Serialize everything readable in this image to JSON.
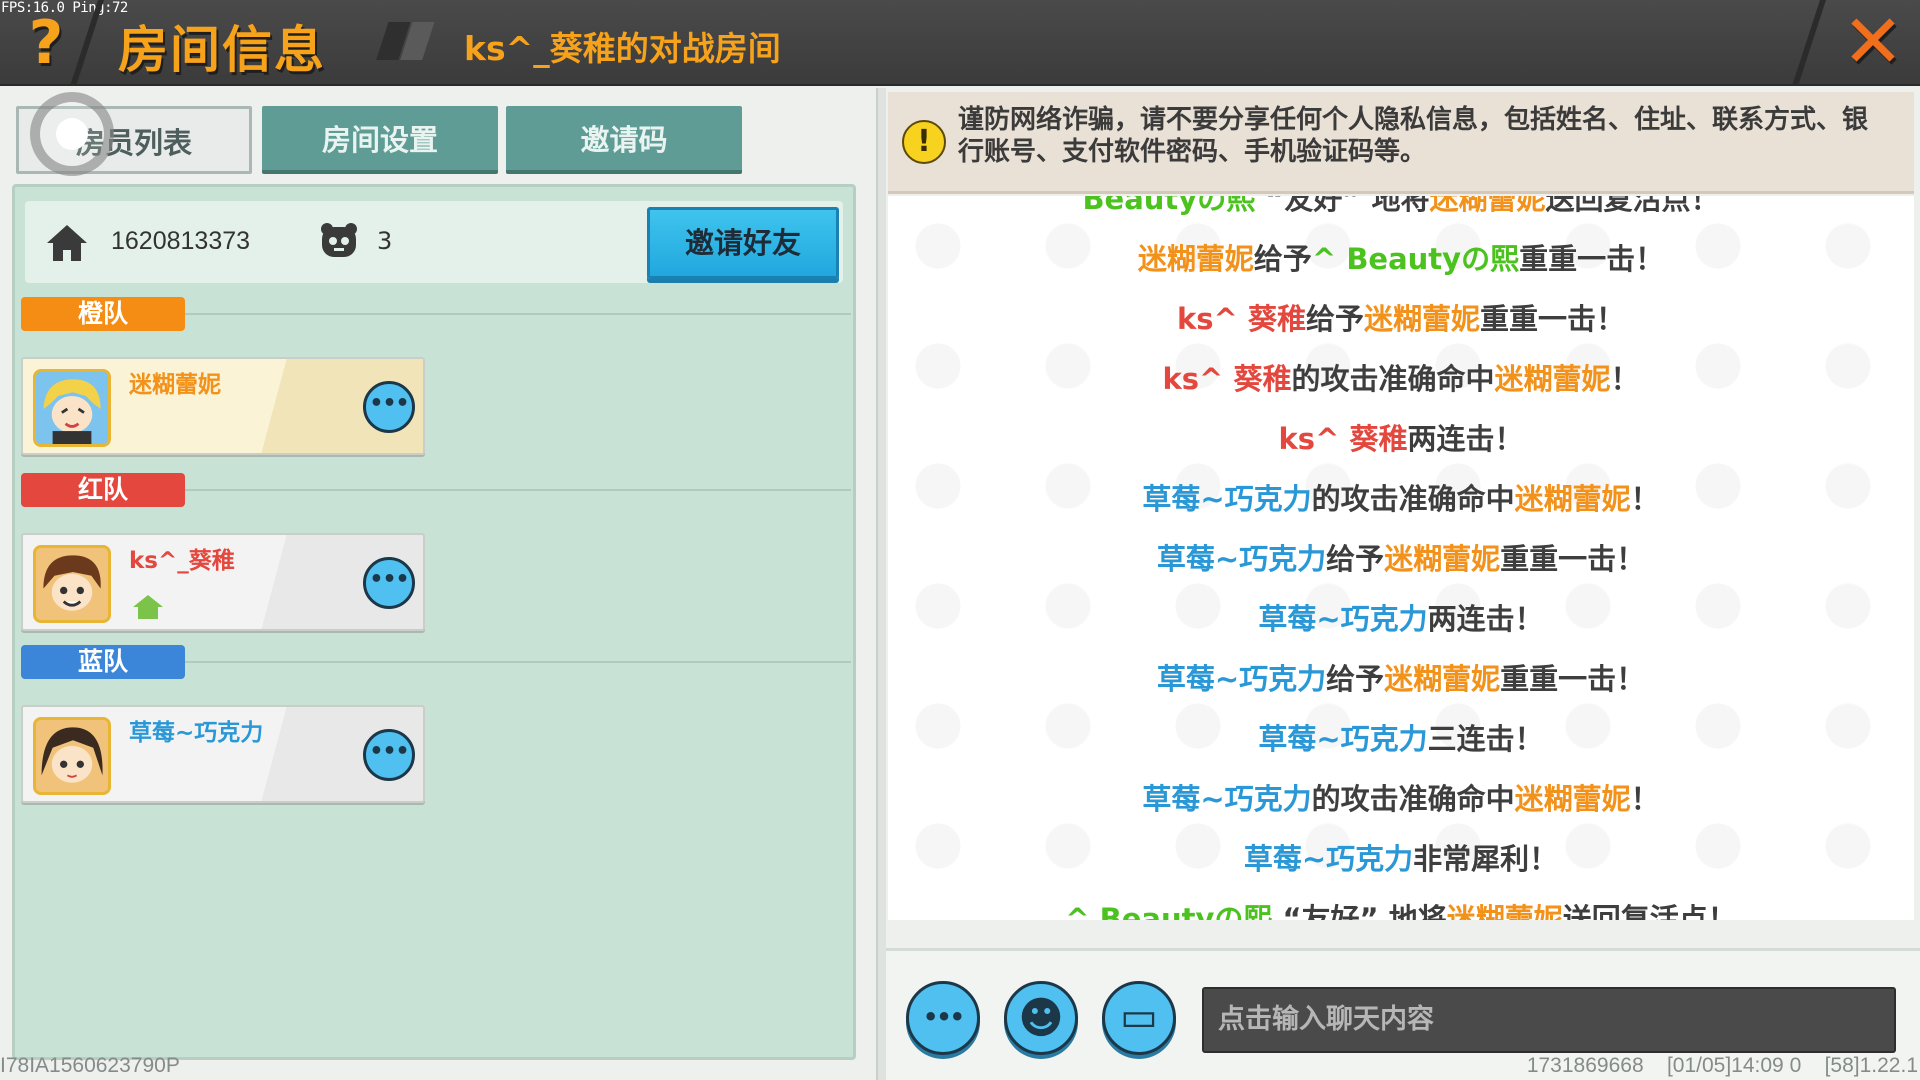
{
  "status": {
    "fps": "FPS:16.0 Ping:72"
  },
  "header": {
    "help_glyph": "?",
    "title": "房间信息",
    "room_name": "ks^_葵稚的对战房间",
    "close_glyph": "✕"
  },
  "tabs": [
    {
      "label": "房员列表",
      "active": true
    },
    {
      "label": "房间设置",
      "active": false
    },
    {
      "label": "邀请码",
      "active": false
    }
  ],
  "room_info": {
    "room_id": "1620813373",
    "player_count": "3",
    "invite_button": "邀请好友"
  },
  "teams": [
    {
      "label": "橙队",
      "color": "#f58c14",
      "members": [
        {
          "name": "迷糊蕾妮",
          "name_color": "#f2921a",
          "is_host": false
        }
      ]
    },
    {
      "label": "红队",
      "color": "#e3473d",
      "members": [
        {
          "name": "ks^_葵稚",
          "name_color": "#e3473d",
          "is_host": true
        }
      ]
    },
    {
      "label": "蓝队",
      "color": "#3b86d8",
      "members": [
        {
          "name": "草莓~巧克力",
          "name_color": "#2a98d6",
          "is_host": false
        }
      ]
    }
  ],
  "warning": {
    "icon": "!",
    "text": "谨防网络诈骗，请不要分享任何个人隐私信息，包括姓名、住址、联系方式、银行账号、支付软件密码、手机验证码等。"
  },
  "chat": {
    "messages": [
      [
        {
          "t": "Beautyの熙",
          "c": "green"
        },
        {
          "t": " “友好” 地将",
          "c": "plain"
        },
        {
          "t": "迷糊蕾妮",
          "c": "orange"
        },
        {
          "t": "送回复活点！",
          "c": "plain"
        }
      ],
      [
        {
          "t": "迷糊蕾妮",
          "c": "orange"
        },
        {
          "t": "给予",
          "c": "plain"
        },
        {
          "t": "^ Beautyの熙",
          "c": "green"
        },
        {
          "t": "重重一击！",
          "c": "plain"
        }
      ],
      [
        {
          "t": "ks^ 葵稚",
          "c": "red"
        },
        {
          "t": "给予",
          "c": "plain"
        },
        {
          "t": "迷糊蕾妮",
          "c": "orange"
        },
        {
          "t": "重重一击！",
          "c": "plain"
        }
      ],
      [
        {
          "t": "ks^ 葵稚",
          "c": "red"
        },
        {
          "t": "的攻击准确命中",
          "c": "plain"
        },
        {
          "t": "迷糊蕾妮",
          "c": "orange"
        },
        {
          "t": "！",
          "c": "plain"
        }
      ],
      [
        {
          "t": "ks^ 葵稚",
          "c": "red"
        },
        {
          "t": "两连击！",
          "c": "plain"
        }
      ],
      [
        {
          "t": "草莓~巧克力",
          "c": "blue"
        },
        {
          "t": "的攻击准确命中",
          "c": "plain"
        },
        {
          "t": "迷糊蕾妮",
          "c": "orange"
        },
        {
          "t": "！",
          "c": "plain"
        }
      ],
      [
        {
          "t": "草莓~巧克力",
          "c": "blue"
        },
        {
          "t": "给予",
          "c": "plain"
        },
        {
          "t": "迷糊蕾妮",
          "c": "orange"
        },
        {
          "t": "重重一击！",
          "c": "plain"
        }
      ],
      [
        {
          "t": "草莓~巧克力",
          "c": "blue"
        },
        {
          "t": "两连击！",
          "c": "plain"
        }
      ],
      [
        {
          "t": "草莓~巧克力",
          "c": "blue"
        },
        {
          "t": "给予",
          "c": "plain"
        },
        {
          "t": "迷糊蕾妮",
          "c": "orange"
        },
        {
          "t": "重重一击！",
          "c": "plain"
        }
      ],
      [
        {
          "t": "草莓~巧克力",
          "c": "blue"
        },
        {
          "t": "三连击！",
          "c": "plain"
        }
      ],
      [
        {
          "t": "草莓~巧克力",
          "c": "blue"
        },
        {
          "t": "的攻击准确命中",
          "c": "plain"
        },
        {
          "t": "迷糊蕾妮",
          "c": "orange"
        },
        {
          "t": "！",
          "c": "plain"
        }
      ],
      [
        {
          "t": "草莓~巧克力",
          "c": "blue"
        },
        {
          "t": "非常犀利！",
          "c": "plain"
        }
      ],
      [
        {
          "t": "^ Beautyの熙",
          "c": "green"
        },
        {
          "t": " “友好” 地将",
          "c": "plain"
        },
        {
          "t": "迷糊蕾妮",
          "c": "orange"
        },
        {
          "t": "送回复活点！",
          "c": "plain"
        }
      ]
    ],
    "more_glyph": "•••",
    "emoji_glyph": "☻",
    "keyboard_glyph": "▭",
    "input_placeholder": "点击输入聊天内容"
  },
  "footer": {
    "left": "I78IA1560623790P",
    "right": "1731869668    [01/05]14:09 0    [58]1.22.1"
  },
  "colors": {
    "accent_orange": "#f7a21b",
    "panel_green": "#c8e3d6",
    "button_blue": "#4fc0f0",
    "name_orange": "#f2921a",
    "name_red": "#e3473d",
    "name_blue": "#2a98d6",
    "name_green": "#4bc21e"
  }
}
